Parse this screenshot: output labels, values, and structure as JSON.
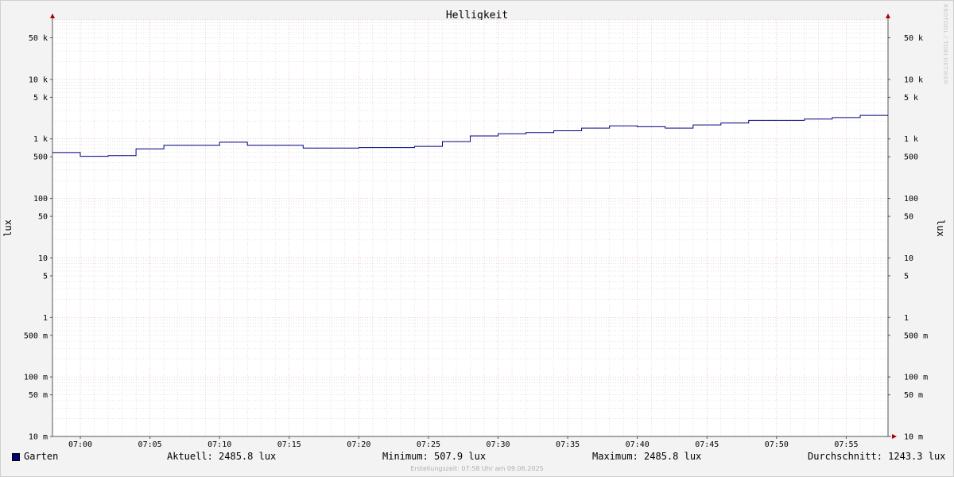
{
  "chart_data": {
    "type": "line",
    "title": "Helligkeit",
    "ylabel_left": "lux",
    "ylabel_right": "lux",
    "yscale": "log",
    "ylim": [
      0.01,
      100000
    ],
    "y_ticks": [
      {
        "value": 50000,
        "label": "50 k"
      },
      {
        "value": 10000,
        "label": "10 k"
      },
      {
        "value": 5000,
        "label": "5 k"
      },
      {
        "value": 1000,
        "label": "1 k"
      },
      {
        "value": 500,
        "label": "500"
      },
      {
        "value": 100,
        "label": "100"
      },
      {
        "value": 50,
        "label": "50"
      },
      {
        "value": 10,
        "label": "10"
      },
      {
        "value": 5,
        "label": "5"
      },
      {
        "value": 1,
        "label": "1"
      },
      {
        "value": 0.5,
        "label": "500 m"
      },
      {
        "value": 0.1,
        "label": "100 m"
      },
      {
        "value": 0.05,
        "label": "50 m"
      },
      {
        "value": 0.01,
        "label": "10 m"
      }
    ],
    "x_range": [
      "06:58",
      "07:58"
    ],
    "x_ticks": [
      "07:00",
      "07:05",
      "07:10",
      "07:15",
      "07:20",
      "07:25",
      "07:30",
      "07:35",
      "07:40",
      "07:45",
      "07:50",
      "07:55"
    ],
    "grid": true,
    "series": [
      {
        "name": "Garten",
        "color": "#000080",
        "step": true,
        "x": [
          "06:58",
          "07:00",
          "07:02",
          "07:04",
          "07:06",
          "07:08",
          "07:10",
          "07:12",
          "07:14",
          "07:16",
          "07:18",
          "07:20",
          "07:22",
          "07:24",
          "07:26",
          "07:28",
          "07:30",
          "07:32",
          "07:34",
          "07:36",
          "07:38",
          "07:40",
          "07:42",
          "07:44",
          "07:46",
          "07:48",
          "07:50",
          "07:52",
          "07:54",
          "07:56"
        ],
        "y": [
          590,
          510,
          525,
          680,
          780,
          780,
          880,
          780,
          780,
          700,
          700,
          715,
          715,
          750,
          900,
          1120,
          1220,
          1280,
          1370,
          1520,
          1650,
          1600,
          1520,
          1720,
          1850,
          2050,
          2050,
          2150,
          2280,
          2485.8
        ]
      }
    ],
    "legend": {
      "series_name": "Garten",
      "aktuell": "Aktuell: 2485.8 lux",
      "minimum": "Minimum: 507.9 lux",
      "maximum": "Maximum: 2485.8 lux",
      "durchschnitt": "Durchschnitt: 1243.3 lux"
    },
    "creation_note": "Erstellungszeit: 07:58 Uhr am 09.06.2025",
    "watermark": "RRDTOOL / TOBI OETIKER",
    "colors": {
      "background": "#f3f3f3",
      "plot_background": "#ffffff",
      "major_grid": "#f0a0a0",
      "minor_grid": "#c8c8c8",
      "axis": "#555555",
      "arrow": "#aa0000"
    }
  }
}
